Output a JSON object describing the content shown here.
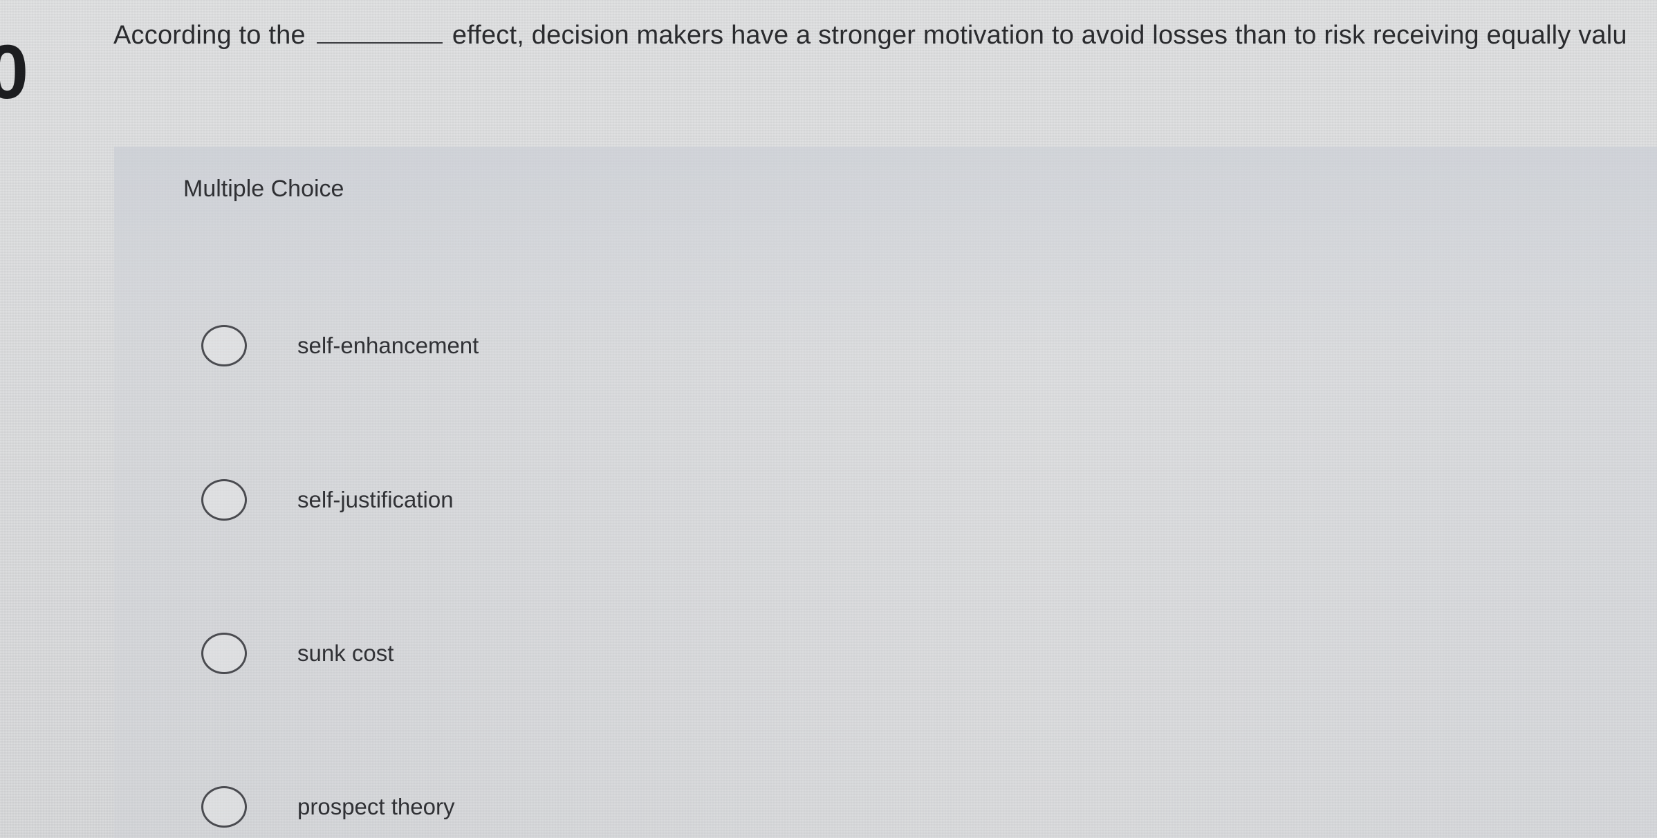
{
  "question": {
    "number": "0",
    "text_before": "According to the",
    "text_after": "effect, decision makers have a stronger motivation to avoid losses than to risk receiving equally valu"
  },
  "multiple_choice": {
    "label": "Multiple Choice",
    "options": [
      {
        "label": "self-enhancement"
      },
      {
        "label": "self-justification"
      },
      {
        "label": "sunk cost"
      },
      {
        "label": "prospect theory"
      }
    ]
  }
}
